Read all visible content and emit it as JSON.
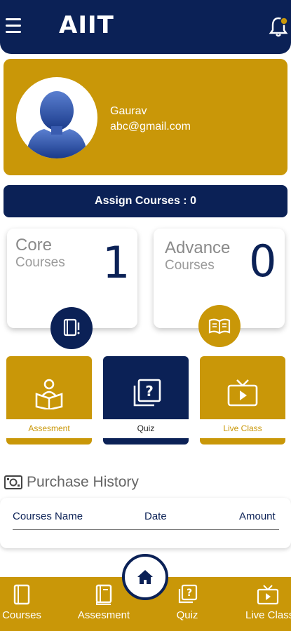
{
  "header": {
    "logo_text": "AIIT",
    "menu_icon": "hamburger-menu-icon",
    "notification_icon": "bell-icon"
  },
  "profile": {
    "name": "Gaurav",
    "email": "abc@gmail.com",
    "avatar_icon": "user-avatar-icon"
  },
  "assign": {
    "label": "Assign Courses : 0"
  },
  "stats": {
    "core": {
      "title": "Core",
      "subtitle": "Courses",
      "count": "1",
      "icon": "book-alert-icon"
    },
    "advance": {
      "title": "Advance",
      "subtitle": "Courses",
      "count": "0",
      "icon": "open-book-icon"
    }
  },
  "tiles": [
    {
      "label": "Assesment",
      "icon": "reader-book-icon"
    },
    {
      "label": "Quiz",
      "icon": "quiz-question-icon"
    },
    {
      "label": "Live Class",
      "icon": "tv-play-icon"
    }
  ],
  "purchase_history": {
    "title": "Purchase History",
    "icon": "money-icon",
    "columns": [
      "Courses Name",
      "Date",
      "Amount"
    ]
  },
  "bottom_nav": {
    "items": [
      {
        "label": "Courses",
        "icon": "book-icon"
      },
      {
        "label": "Assesment",
        "icon": "notebook-icon"
      },
      {
        "label": "Quiz",
        "icon": "quiz-question-icon"
      },
      {
        "label": "Live Class",
        "icon": "tv-play-icon"
      }
    ],
    "home_icon": "home-icon"
  },
  "colors": {
    "navy": "#0b2156",
    "gold": "#c99708"
  }
}
